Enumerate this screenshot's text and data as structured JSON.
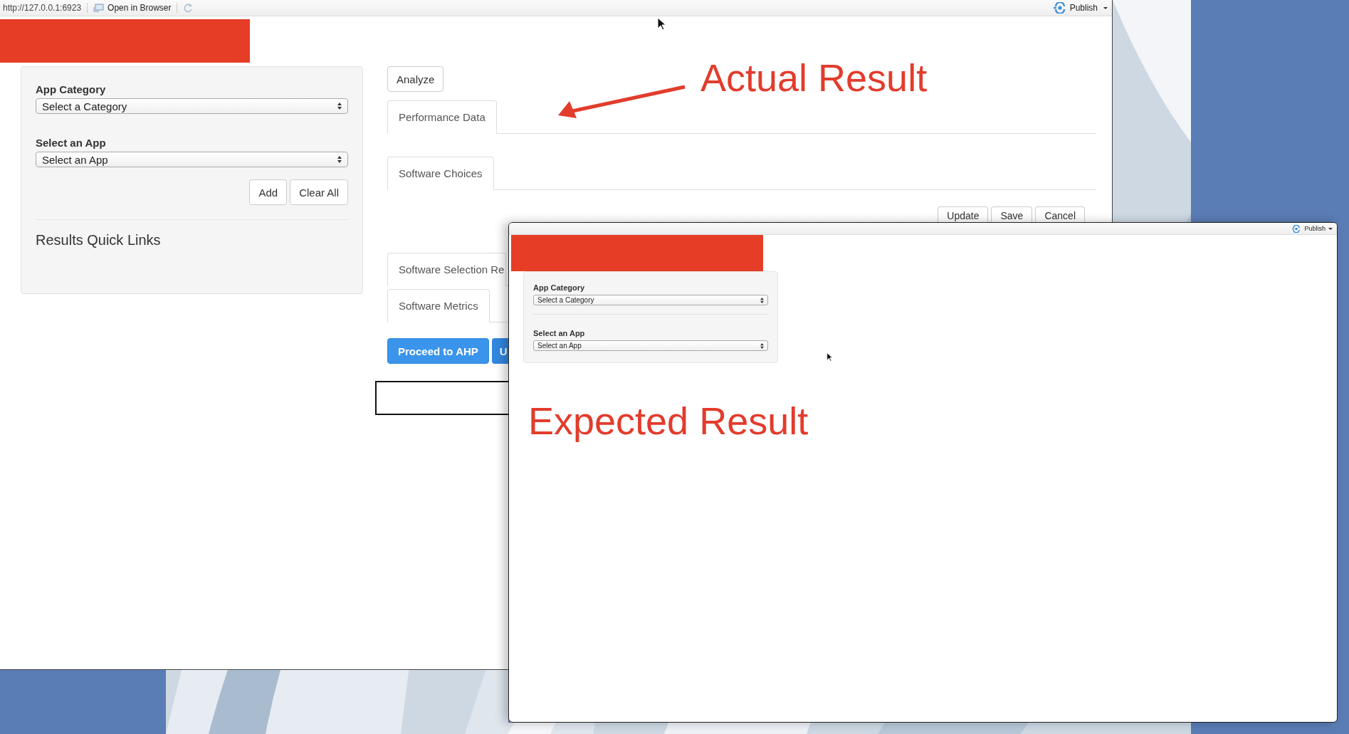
{
  "actual_window": {
    "toolbar": {
      "url": "http://127.0.0.1:6923",
      "open_in_browser": "Open in Browser",
      "publish": "Publish"
    },
    "sidebar": {
      "fields": [
        {
          "label": "App Category",
          "placeholder": "Select a Category"
        },
        {
          "label": "Select an App",
          "placeholder": "Select an App"
        }
      ],
      "buttons": [
        "Add",
        "Clear All"
      ],
      "heading": "Results Quick Links"
    },
    "main": [
      {
        "kind": "button",
        "label": "Analyze"
      },
      {
        "kind": "tabset",
        "tabs": [
          {
            "label": "Performance Data",
            "selected": true
          }
        ]
      },
      {
        "kind": "tabset",
        "tabs": [
          {
            "label": "Software Choices",
            "selected": true
          }
        ]
      },
      {
        "kind": "actions",
        "buttons": [
          "Update",
          "Save",
          "Cancel"
        ]
      },
      {
        "kind": "tabset",
        "tabs": [
          {
            "label": "Software Selection Re",
            "selected": true
          }
        ]
      },
      {
        "kind": "tabset",
        "tabs": [
          {
            "label": "Software Metrics",
            "selected": true
          }
        ]
      },
      {
        "kind": "primary_actions",
        "buttons": [
          "Proceed to AHP",
          "U"
        ]
      },
      {
        "kind": "output"
      }
    ]
  },
  "expected_window": {
    "toolbar": {
      "publish": "Publish"
    },
    "sidebar": {
      "fields": [
        {
          "label": "App Category",
          "placeholder": "Select a Category"
        },
        {
          "label": "Select an App",
          "placeholder": "Select an App"
        }
      ]
    }
  },
  "annotations": [
    {
      "kind": "actual",
      "text": "Actual Result"
    },
    {
      "kind": "expected",
      "text": "Expected Result"
    }
  ]
}
